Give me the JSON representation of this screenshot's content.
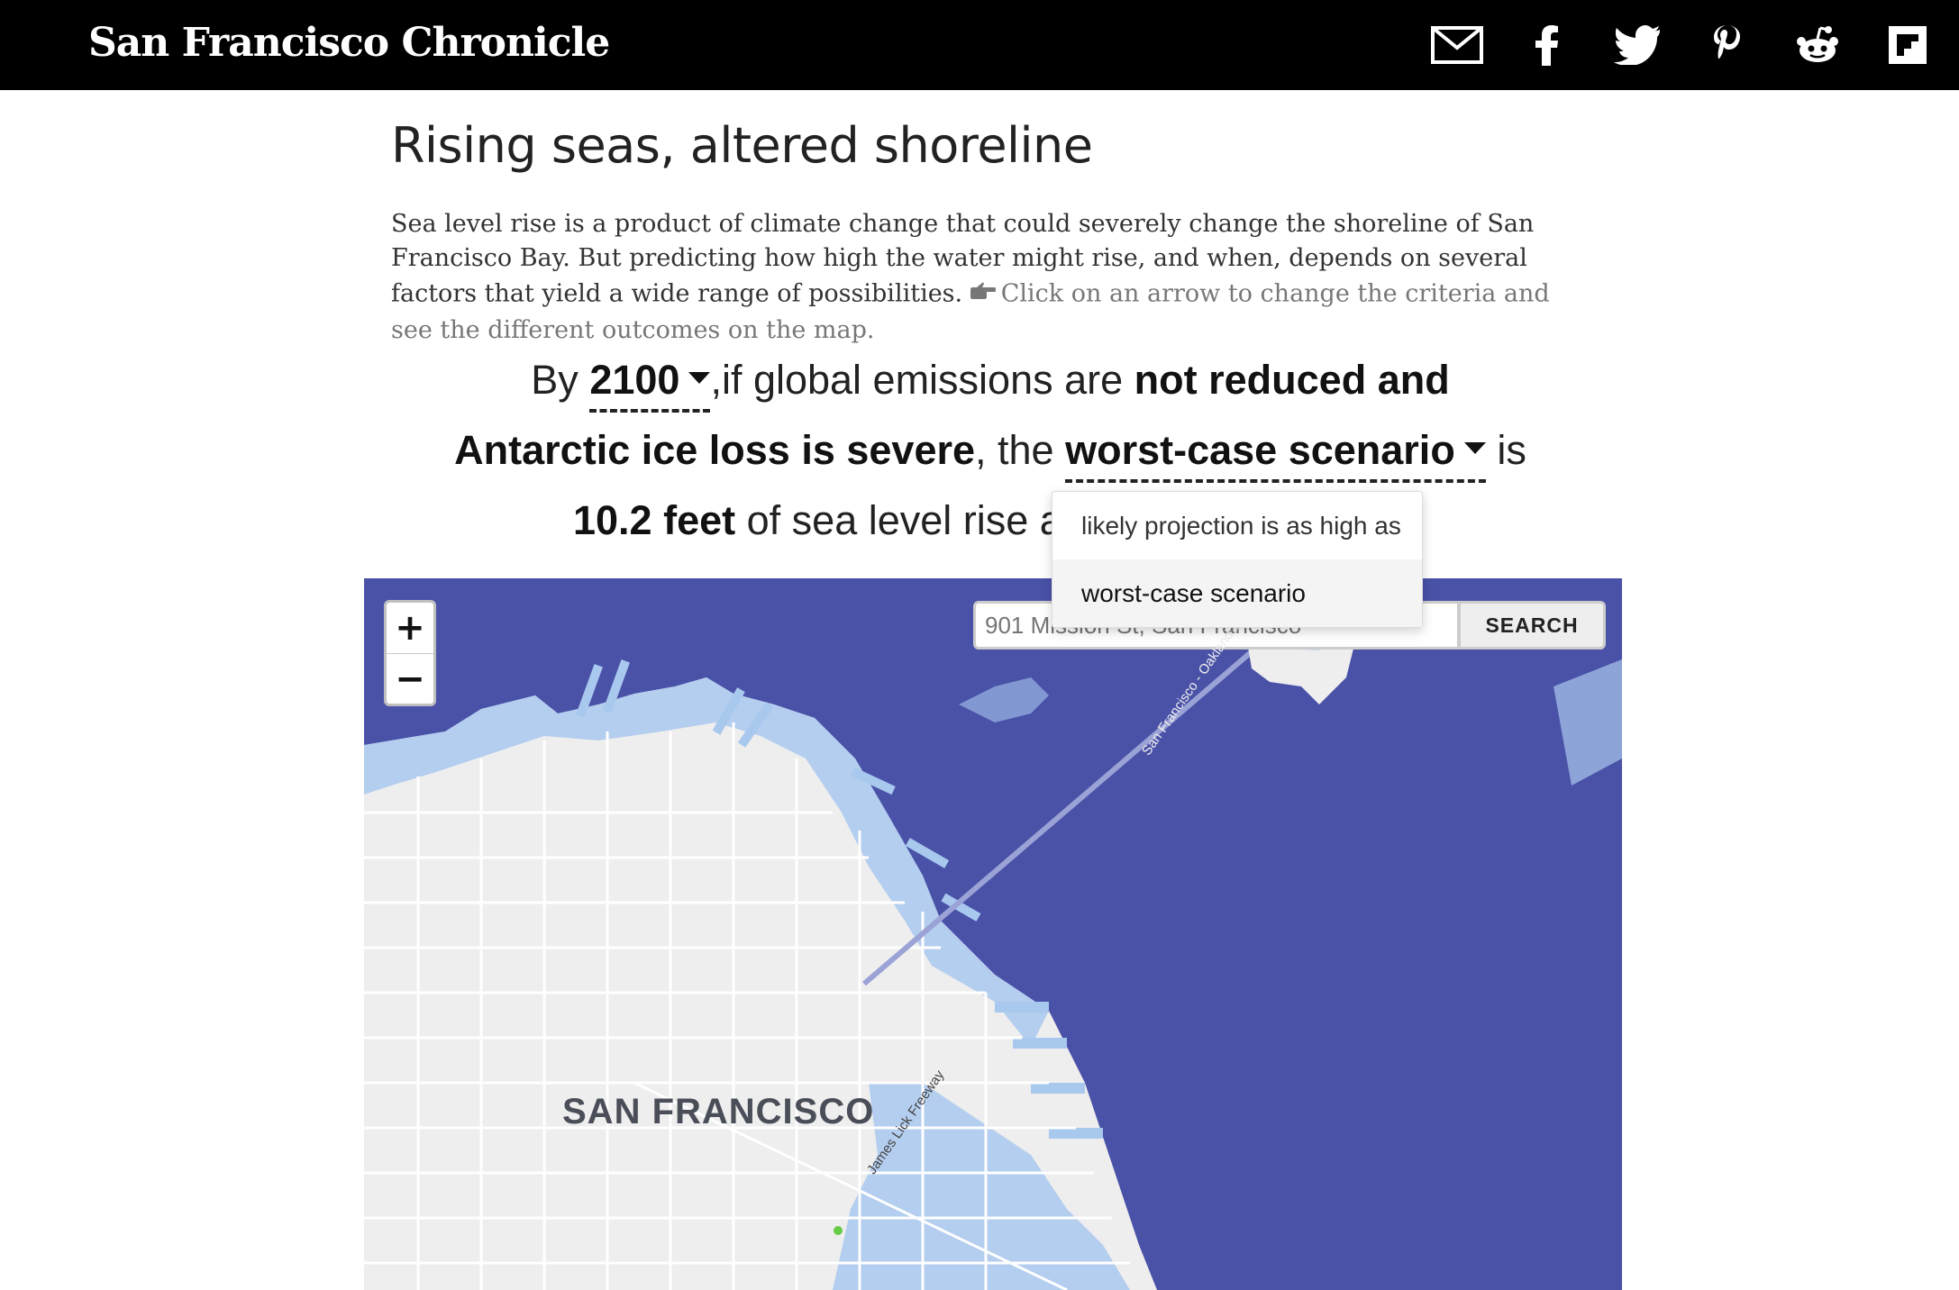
{
  "header": {
    "logo": "San Francisco Chronicle",
    "share_icons": [
      "email-icon",
      "facebook-icon",
      "twitter-icon",
      "pinterest-icon",
      "reddit-icon",
      "flipboard-icon"
    ]
  },
  "article": {
    "headline": "Rising seas, altered shoreline",
    "intro": "Sea level rise is a product of climate change that could severely change the shoreline of San Francisco Bay. But predicting how high the water might rise, and when, depends on several factors that yield a wide range of possibilities.",
    "hint": "Click on an arrow to change the criteria and see the different outcomes on the map."
  },
  "scenario": {
    "by": "By",
    "year": "2100",
    "if_text": ",if global emissions are",
    "emissions": "not reduced and",
    "ice_loss": "Antarctic ice loss is severe",
    "the": ", the",
    "outcome": "worst-case scenario",
    "is": "is",
    "amount": "10.2 feet",
    "rest": "of sea level rise alo"
  },
  "outcome_menu": {
    "options": [
      "likely projection is as high as",
      "worst-case scenario"
    ],
    "selected": "worst-case scenario"
  },
  "map": {
    "zoom_in": "+",
    "zoom_out": "−",
    "search_placeholder": "901 Mission St, San Francisco",
    "search_button": "SEARCH",
    "city_label": "SAN FRANCISCO",
    "bridge_label": "San Francisco - Oakland Bay Bridge",
    "freeway_label": "James Lick Freeway",
    "colors": {
      "water": "#4a52a8",
      "flood": "#a9c8ee",
      "land": "#eeeeee"
    }
  }
}
